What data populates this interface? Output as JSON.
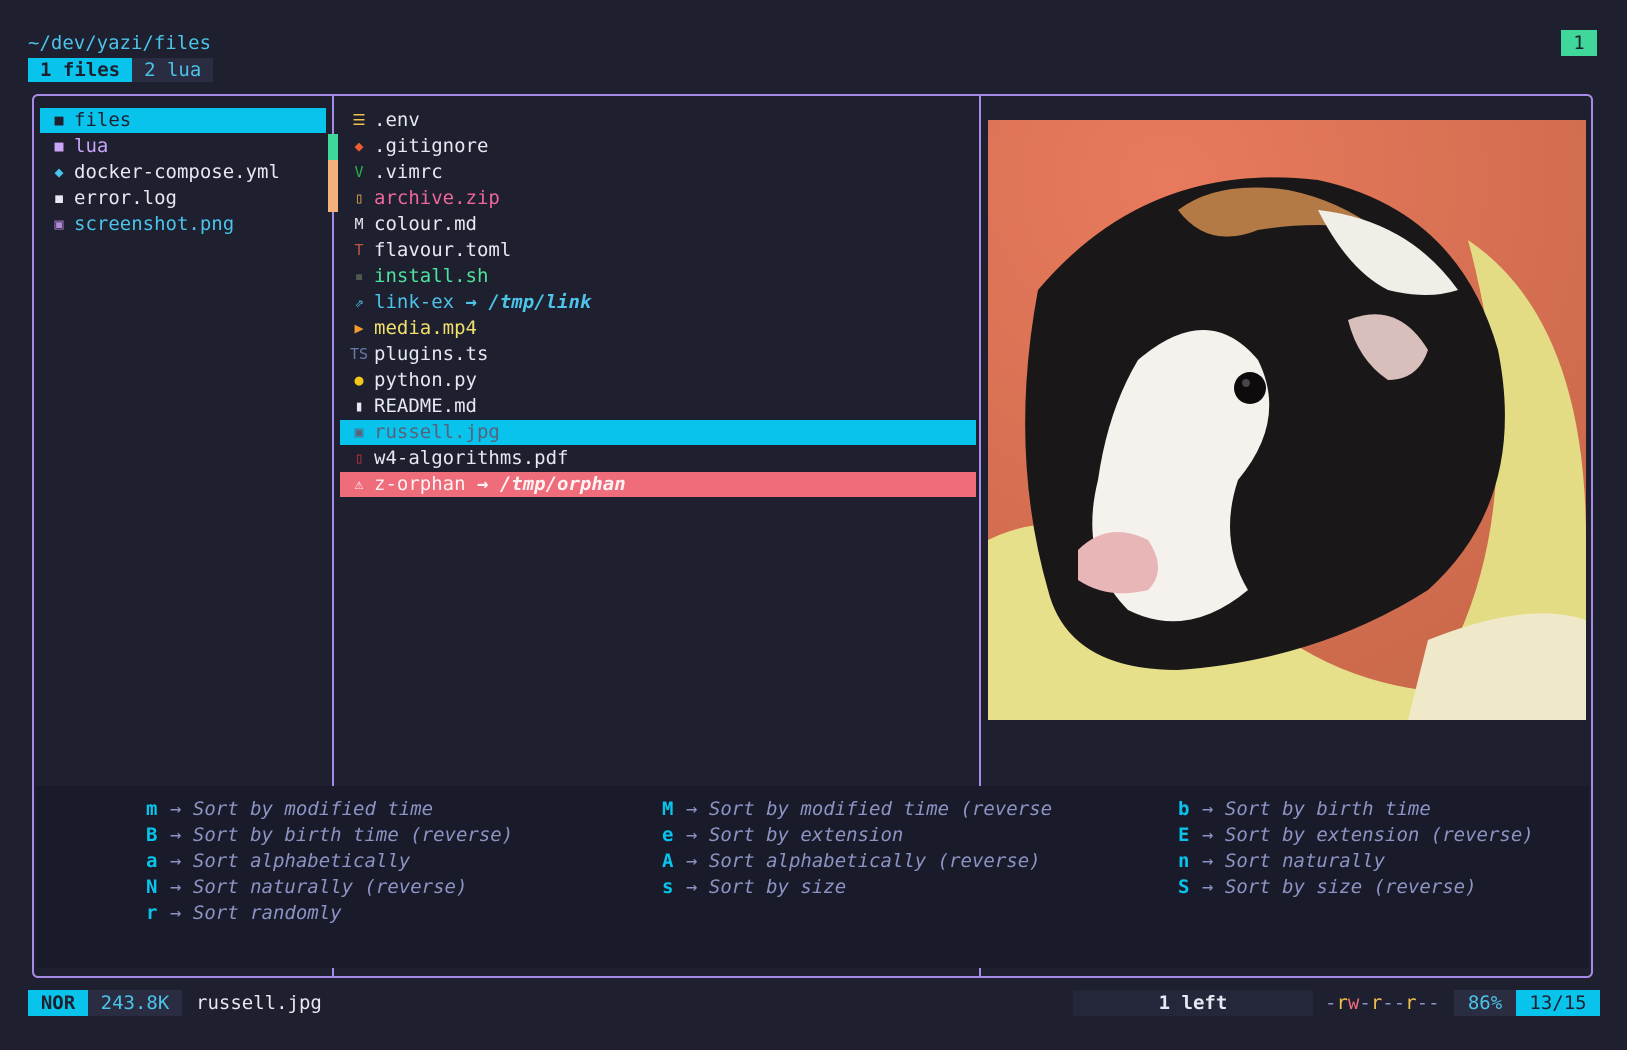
{
  "header": {
    "path": "~/dev/yazi/files",
    "tabs": [
      {
        "label": "1 files",
        "active": true
      },
      {
        "label": "2 lua",
        "active": false
      }
    ],
    "tab_count": "1"
  },
  "parent_pane": {
    "items": [
      {
        "name": "files",
        "icon": "folder-icon",
        "color": "#1e2030",
        "selected": true
      },
      {
        "name": "lua",
        "icon": "folder-icon",
        "color": "#c9a4f7",
        "selected": false
      },
      {
        "name": "docker-compose.yml",
        "icon": "docker-icon",
        "color": "#e6e8f2",
        "selected": false
      },
      {
        "name": "error.log",
        "icon": "log-icon",
        "color": "#e6e8f2",
        "selected": false
      },
      {
        "name": "screenshot.png",
        "icon": "image-icon",
        "color": "#4cc3e8",
        "selected": false
      }
    ]
  },
  "current_pane": {
    "items": [
      {
        "name": ".env",
        "icon": "settings-icon",
        "glyph": "☰",
        "icon_color": "#f1c24b",
        "color": "#e6e8f2"
      },
      {
        "name": ".gitignore",
        "icon": "git-icon",
        "glyph": "◆",
        "icon_color": "#f05a35",
        "color": "#e6e8f2"
      },
      {
        "name": ".vimrc",
        "icon": "vim-icon",
        "glyph": "V",
        "icon_color": "#2bb24c",
        "color": "#e6e8f2"
      },
      {
        "name": "archive.zip",
        "icon": "zip-icon",
        "glyph": "▯",
        "icon_color": "#e8a64a",
        "color": "#f0669a"
      },
      {
        "name": "colour.md",
        "icon": "markdown-icon",
        "glyph": "M",
        "icon_color": "#e6e8f2",
        "color": "#e6e8f2"
      },
      {
        "name": "flavour.toml",
        "icon": "toml-icon",
        "glyph": "T",
        "icon_color": "#c2543d",
        "color": "#e6e8f2"
      },
      {
        "name": "install.sh",
        "icon": "terminal-icon",
        "glyph": "▪",
        "icon_color": "#4f5a4f",
        "color": "#4ee39c"
      },
      {
        "name": "link-ex",
        "link": " → /tmp/link",
        "icon": "link-icon",
        "glyph": "⇗",
        "icon_color": "#4cc3e8",
        "color": "#4cc3e8"
      },
      {
        "name": "media.mp4",
        "icon": "video-icon",
        "glyph": "▶",
        "icon_color": "#f39c2a",
        "color": "#f1e06b"
      },
      {
        "name": "plugins.ts",
        "icon": "typescript-icon",
        "glyph": "TS",
        "icon_color": "#6b7ba8",
        "color": "#e6e8f2"
      },
      {
        "name": "python.py",
        "icon": "python-icon",
        "glyph": "●",
        "icon_color": "#f5c518",
        "color": "#e6e8f2"
      },
      {
        "name": "README.md",
        "icon": "readme-icon",
        "glyph": "▮",
        "icon_color": "#e6e8f2",
        "color": "#e6e8f2"
      },
      {
        "name": "russell.jpg",
        "icon": "image-icon",
        "glyph": "▣",
        "icon_color": "#5b607a",
        "color": "#5b607a",
        "selected": true
      },
      {
        "name": "w4-algorithms.pdf",
        "icon": "pdf-icon",
        "glyph": "▯",
        "icon_color": "#c6303e",
        "color": "#e6e8f2"
      },
      {
        "name": "z-orphan",
        "link": " → /tmp/orphan",
        "icon": "warning-icon",
        "glyph": "⚠",
        "icon_color": "#fdf2f4",
        "color": "#fdf2f4",
        "orphan": true
      }
    ]
  },
  "help": {
    "columns": [
      [
        {
          "key": "m",
          "desc": "Sort by modified time"
        },
        {
          "key": "B",
          "desc": "Sort by birth time (reverse)"
        },
        {
          "key": "a",
          "desc": "Sort alphabetically"
        },
        {
          "key": "N",
          "desc": "Sort naturally (reverse)"
        },
        {
          "key": "r",
          "desc": "Sort randomly"
        }
      ],
      [
        {
          "key": "M",
          "desc": "Sort by modified time (reverse"
        },
        {
          "key": "e",
          "desc": "Sort by extension"
        },
        {
          "key": "A",
          "desc": "Sort alphabetically (reverse)"
        },
        {
          "key": "s",
          "desc": "Sort by size"
        }
      ],
      [
        {
          "key": "b",
          "desc": "Sort by birth time"
        },
        {
          "key": "E",
          "desc": "Sort by extension (reverse)"
        },
        {
          "key": "n",
          "desc": "Sort naturally"
        },
        {
          "key": "S",
          "desc": "Sort by size (reverse)"
        }
      ]
    ]
  },
  "status": {
    "mode": "NOR",
    "size": "243.8K",
    "filename": "russell.jpg",
    "left": "1 left",
    "permissions": [
      {
        "ch": "-",
        "color": "#8d94c4"
      },
      {
        "ch": "r",
        "color": "#f1c24b"
      },
      {
        "ch": "w",
        "color": "#ef6d7a"
      },
      {
        "ch": "-",
        "color": "#8d94c4"
      },
      {
        "ch": "r",
        "color": "#f1c24b"
      },
      {
        "ch": "-",
        "color": "#8d94c4"
      },
      {
        "ch": "-",
        "color": "#8d94c4"
      },
      {
        "ch": "r",
        "color": "#f1c24b"
      },
      {
        "ch": "-",
        "color": "#8d94c4"
      },
      {
        "ch": "-",
        "color": "#8d94c4"
      }
    ],
    "percent": "86%",
    "position": "13/15"
  },
  "colors": {
    "accent": "#08c4ec",
    "border": "#a789e6",
    "background": "#1e2030"
  }
}
